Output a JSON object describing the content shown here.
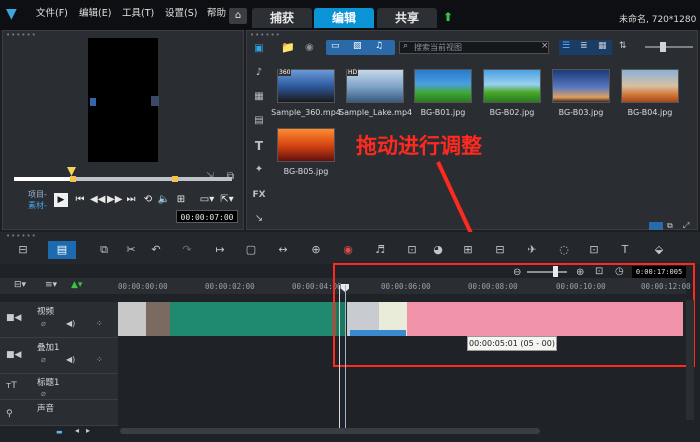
{
  "menu": {
    "items": [
      "文件(F)",
      "编辑(E)",
      "工具(T)",
      "设置(S)",
      "帮助"
    ],
    "tabs": [
      {
        "label": "捕获",
        "active": false
      },
      {
        "label": "编辑",
        "active": true
      },
      {
        "label": "共享",
        "active": false
      }
    ],
    "project_info": "未命名, 720*1280"
  },
  "player": {
    "project_label": "项目-",
    "clip_label": "素材-",
    "timecode": "00:00:07:00"
  },
  "library": {
    "search_placeholder": "搜索当前视图",
    "items": [
      {
        "name": "Sample_360.mp4",
        "badge": "360"
      },
      {
        "name": "Sample_Lake.mp4",
        "badge": "HD"
      },
      {
        "name": "BG-B01.jpg",
        "badge": ""
      },
      {
        "name": "BG-B02.jpg",
        "badge": ""
      },
      {
        "name": "BG-B03.jpg",
        "badge": ""
      },
      {
        "name": "BG-B04.jpg",
        "badge": ""
      },
      {
        "name": "BG-B05.jpg",
        "badge": ""
      }
    ],
    "fx_label": "FX",
    "annotation": "拖动进行调整"
  },
  "timeline": {
    "timecode": "0:00:17:005",
    "ruler": [
      "00:00:00:00",
      "00:00:02:00",
      "00:00:04:00",
      "00:00:06:00",
      "00:00:08:00",
      "00:00:10:00",
      "00:00:12:00"
    ],
    "tracks": [
      {
        "label": "视频",
        "icon": "video-track-icon"
      },
      {
        "label": "叠加1",
        "icon": "overlay-track-icon"
      },
      {
        "label": "标题1",
        "icon": "title-track-icon"
      },
      {
        "label": "声音",
        "icon": "voice-track-icon"
      }
    ],
    "tooltip": "00:00:05:01 (05 - 00)"
  },
  "colors": {
    "accent": "#0a94d6",
    "annotation_red": "#ff2a1f",
    "clip_green": "#1f8a6e",
    "clip_pink": "#f093a8"
  }
}
